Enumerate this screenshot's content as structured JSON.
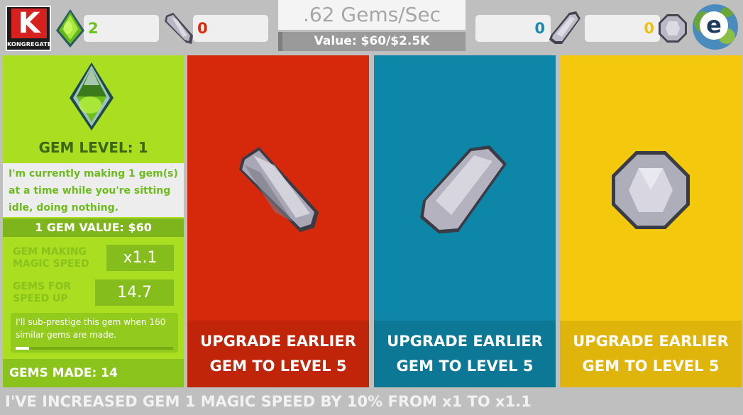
{
  "header": {
    "logo_text": "KONGREGATE",
    "logo_letter": "K",
    "gem_counts": {
      "green": "2",
      "red": "0",
      "blue": "0",
      "yellow": "0"
    },
    "rate": ".62 Gems/Sec",
    "value": "Value: $60/$2.5K",
    "value_progress": 0.024,
    "globe_letter": "e"
  },
  "left_panel": {
    "gem_level": "GEM LEVEL: 1",
    "description": "I'm currently making 1 gem(s) at a time while you're sitting idle, doing nothing.",
    "gem_value": "1 GEM VALUE: $60",
    "speed_label": "GEM MAKING MAGIC SPEED",
    "speed_value": "x1.1",
    "speedup_label": "GEMS FOR SPEED UP",
    "speedup_value": "14.7",
    "note": "I'll sub-prestige this gem when 160 similar gems are made.",
    "note_progress": 0.0875,
    "gems_made": "GEMS MADE: 14"
  },
  "columns": [
    {
      "button_line1": "UPGRADE EARLIER",
      "button_line2": "GEM TO LEVEL 5",
      "bg": "#d6280b",
      "button_bg": "#c0250a"
    },
    {
      "button_line1": "UPGRADE EARLIER",
      "button_line2": "GEM TO LEVEL 5",
      "bg": "#0d86a8",
      "button_bg": "#0c7895"
    },
    {
      "button_line1": "UPGRADE EARLIER",
      "button_line2": "GEM TO LEVEL 5",
      "bg": "#f4c80c",
      "button_bg": "#e0b50b"
    }
  ],
  "message": "I'VE INCREASED GEM 1 MAGIC SPEED BY 10% FROM x1 TO x1.1",
  "colors": {
    "green_accent": "#a9de21",
    "red_accent": "#d6280b",
    "blue_accent": "#1287ad",
    "yellow_accent": "#f4c80c"
  }
}
